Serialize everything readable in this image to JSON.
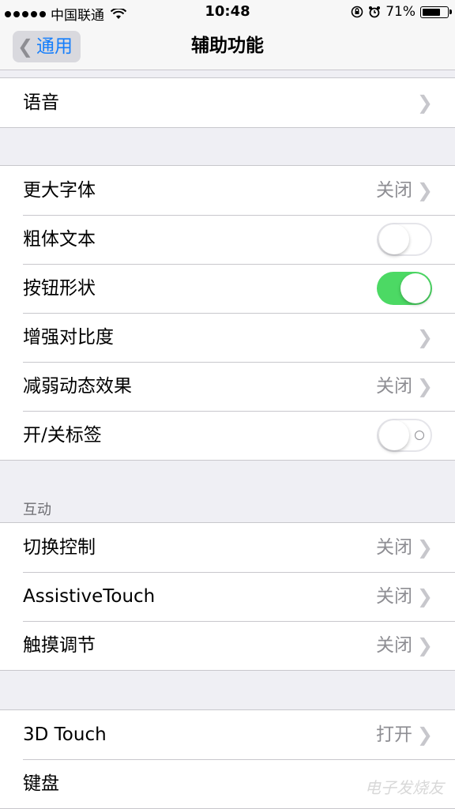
{
  "status_bar": {
    "carrier": "中国联通",
    "time": "10:48",
    "battery": "71%",
    "battery_level": 0.71
  },
  "nav": {
    "back_label": "通用",
    "title": "辅助功能"
  },
  "groups": {
    "top": {
      "rows": [
        {
          "label": "语音"
        }
      ]
    },
    "display": {
      "rows": [
        {
          "label": "更大字体",
          "value": "关闭"
        },
        {
          "label": "粗体文本",
          "toggle": false
        },
        {
          "label": "按钮形状",
          "toggle": true
        },
        {
          "label": "增强对比度"
        },
        {
          "label": "减弱动态效果",
          "value": "关闭"
        },
        {
          "label": "开/关标签",
          "toggle": false
        }
      ]
    },
    "interaction": {
      "header": "互动",
      "rows": [
        {
          "label": "切换控制",
          "value": "关闭"
        },
        {
          "label": "AssistiveTouch",
          "value": "关闭"
        },
        {
          "label": "触摸调节",
          "value": "关闭"
        }
      ]
    },
    "touch": {
      "rows": [
        {
          "label": "3D Touch",
          "value": "打开"
        },
        {
          "label": "键盘"
        }
      ]
    }
  },
  "watermark": "电子发烧友",
  "colors": {
    "accent": "#157efb",
    "toggle_on": "#4cd964"
  }
}
